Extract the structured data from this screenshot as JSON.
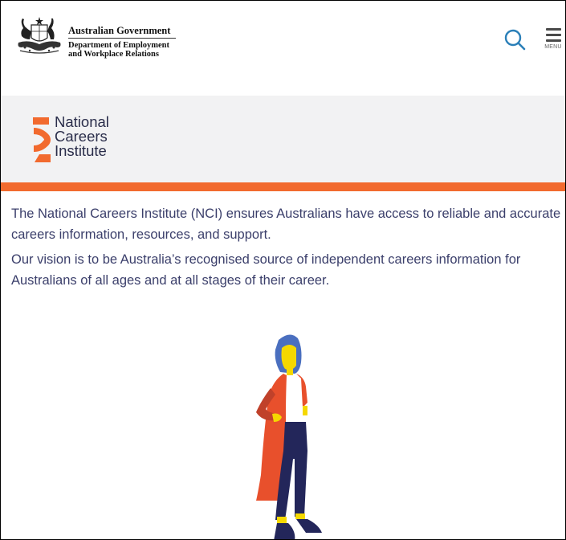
{
  "header": {
    "gov_name": "Australian Government",
    "dept_line1": "Department of Employment",
    "dept_line2": "and Workplace Relations",
    "search_icon": "search-icon",
    "menu_icon": "hamburger-menu-icon",
    "menu_label": "MENU"
  },
  "brand": {
    "line1": "National",
    "line2": "Careers",
    "line3": "Institute",
    "accent_color": "#f26a2e",
    "text_color": "#2a2d4a"
  },
  "content": {
    "paragraph1": "The National Careers Institute (NCI) ensures Australians have access to reliable and accurate careers information, resources, and support.",
    "paragraph2": "Our vision is to be Australia’s recognised source of independent careers information for Australians of all ages and at all stages of their career."
  },
  "colors": {
    "orange": "#f26a2e",
    "navy": "#23265a",
    "yellow": "#f5d800",
    "blue_hair": "#4a6fbf",
    "band_grey": "#f2f2f3"
  }
}
